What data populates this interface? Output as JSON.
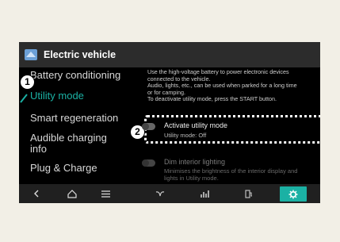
{
  "window": {
    "title": "Electric vehicle"
  },
  "menu": {
    "items": [
      {
        "label": "Battery conditioning",
        "active": false
      },
      {
        "label": "Utility mode",
        "active": true
      },
      {
        "label": "Smart regeneration",
        "active": false
      },
      {
        "label": "Audible charging",
        "label2": "info",
        "active": false
      },
      {
        "label": "Plug & Charge",
        "active": false
      }
    ]
  },
  "callouts": {
    "one": "1",
    "two": "2"
  },
  "description": {
    "lines": [
      "Use the high-voltage battery to power electronic devices",
      "connected to the vehicle.",
      "Audio, lights, etc., can be used when parked for a long time",
      "or for camping.",
      "To deactivate utility mode, press the START button."
    ]
  },
  "settings": {
    "utility_mode": {
      "label": "Activate utility mode",
      "status": "Utility mode: Off"
    },
    "dim_lighting": {
      "label": "Dim interior lighting",
      "status_lines": [
        "Minimises the brightness of the interior display and",
        "lights in Utility mode."
      ]
    }
  },
  "navbar": {
    "icons": [
      "back-icon",
      "home-icon",
      "menu-icon",
      "leaf-icon",
      "stats-icon",
      "charger-icon",
      "gear-icon"
    ],
    "accent": "#1bb1a4"
  },
  "colors": {
    "accent": "#1bb1a4",
    "background": "#000000"
  }
}
